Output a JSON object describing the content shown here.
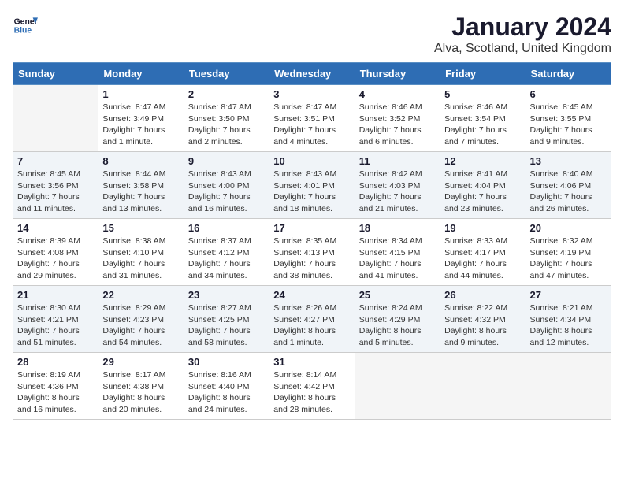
{
  "header": {
    "logo_line1": "General",
    "logo_line2": "Blue",
    "month_title": "January 2024",
    "location": "Alva, Scotland, United Kingdom"
  },
  "days_of_week": [
    "Sunday",
    "Monday",
    "Tuesday",
    "Wednesday",
    "Thursday",
    "Friday",
    "Saturday"
  ],
  "weeks": [
    [
      {
        "day": "",
        "info": ""
      },
      {
        "day": "1",
        "info": "Sunrise: 8:47 AM\nSunset: 3:49 PM\nDaylight: 7 hours\nand 1 minute."
      },
      {
        "day": "2",
        "info": "Sunrise: 8:47 AM\nSunset: 3:50 PM\nDaylight: 7 hours\nand 2 minutes."
      },
      {
        "day": "3",
        "info": "Sunrise: 8:47 AM\nSunset: 3:51 PM\nDaylight: 7 hours\nand 4 minutes."
      },
      {
        "day": "4",
        "info": "Sunrise: 8:46 AM\nSunset: 3:52 PM\nDaylight: 7 hours\nand 6 minutes."
      },
      {
        "day": "5",
        "info": "Sunrise: 8:46 AM\nSunset: 3:54 PM\nDaylight: 7 hours\nand 7 minutes."
      },
      {
        "day": "6",
        "info": "Sunrise: 8:45 AM\nSunset: 3:55 PM\nDaylight: 7 hours\nand 9 minutes."
      }
    ],
    [
      {
        "day": "7",
        "info": "Sunrise: 8:45 AM\nSunset: 3:56 PM\nDaylight: 7 hours\nand 11 minutes."
      },
      {
        "day": "8",
        "info": "Sunrise: 8:44 AM\nSunset: 3:58 PM\nDaylight: 7 hours\nand 13 minutes."
      },
      {
        "day": "9",
        "info": "Sunrise: 8:43 AM\nSunset: 4:00 PM\nDaylight: 7 hours\nand 16 minutes."
      },
      {
        "day": "10",
        "info": "Sunrise: 8:43 AM\nSunset: 4:01 PM\nDaylight: 7 hours\nand 18 minutes."
      },
      {
        "day": "11",
        "info": "Sunrise: 8:42 AM\nSunset: 4:03 PM\nDaylight: 7 hours\nand 21 minutes."
      },
      {
        "day": "12",
        "info": "Sunrise: 8:41 AM\nSunset: 4:04 PM\nDaylight: 7 hours\nand 23 minutes."
      },
      {
        "day": "13",
        "info": "Sunrise: 8:40 AM\nSunset: 4:06 PM\nDaylight: 7 hours\nand 26 minutes."
      }
    ],
    [
      {
        "day": "14",
        "info": "Sunrise: 8:39 AM\nSunset: 4:08 PM\nDaylight: 7 hours\nand 29 minutes."
      },
      {
        "day": "15",
        "info": "Sunrise: 8:38 AM\nSunset: 4:10 PM\nDaylight: 7 hours\nand 31 minutes."
      },
      {
        "day": "16",
        "info": "Sunrise: 8:37 AM\nSunset: 4:12 PM\nDaylight: 7 hours\nand 34 minutes."
      },
      {
        "day": "17",
        "info": "Sunrise: 8:35 AM\nSunset: 4:13 PM\nDaylight: 7 hours\nand 38 minutes."
      },
      {
        "day": "18",
        "info": "Sunrise: 8:34 AM\nSunset: 4:15 PM\nDaylight: 7 hours\nand 41 minutes."
      },
      {
        "day": "19",
        "info": "Sunrise: 8:33 AM\nSunset: 4:17 PM\nDaylight: 7 hours\nand 44 minutes."
      },
      {
        "day": "20",
        "info": "Sunrise: 8:32 AM\nSunset: 4:19 PM\nDaylight: 7 hours\nand 47 minutes."
      }
    ],
    [
      {
        "day": "21",
        "info": "Sunrise: 8:30 AM\nSunset: 4:21 PM\nDaylight: 7 hours\nand 51 minutes."
      },
      {
        "day": "22",
        "info": "Sunrise: 8:29 AM\nSunset: 4:23 PM\nDaylight: 7 hours\nand 54 minutes."
      },
      {
        "day": "23",
        "info": "Sunrise: 8:27 AM\nSunset: 4:25 PM\nDaylight: 7 hours\nand 58 minutes."
      },
      {
        "day": "24",
        "info": "Sunrise: 8:26 AM\nSunset: 4:27 PM\nDaylight: 8 hours\nand 1 minute."
      },
      {
        "day": "25",
        "info": "Sunrise: 8:24 AM\nSunset: 4:29 PM\nDaylight: 8 hours\nand 5 minutes."
      },
      {
        "day": "26",
        "info": "Sunrise: 8:22 AM\nSunset: 4:32 PM\nDaylight: 8 hours\nand 9 minutes."
      },
      {
        "day": "27",
        "info": "Sunrise: 8:21 AM\nSunset: 4:34 PM\nDaylight: 8 hours\nand 12 minutes."
      }
    ],
    [
      {
        "day": "28",
        "info": "Sunrise: 8:19 AM\nSunset: 4:36 PM\nDaylight: 8 hours\nand 16 minutes."
      },
      {
        "day": "29",
        "info": "Sunrise: 8:17 AM\nSunset: 4:38 PM\nDaylight: 8 hours\nand 20 minutes."
      },
      {
        "day": "30",
        "info": "Sunrise: 8:16 AM\nSunset: 4:40 PM\nDaylight: 8 hours\nand 24 minutes."
      },
      {
        "day": "31",
        "info": "Sunrise: 8:14 AM\nSunset: 4:42 PM\nDaylight: 8 hours\nand 28 minutes."
      },
      {
        "day": "",
        "info": ""
      },
      {
        "day": "",
        "info": ""
      },
      {
        "day": "",
        "info": ""
      }
    ]
  ]
}
